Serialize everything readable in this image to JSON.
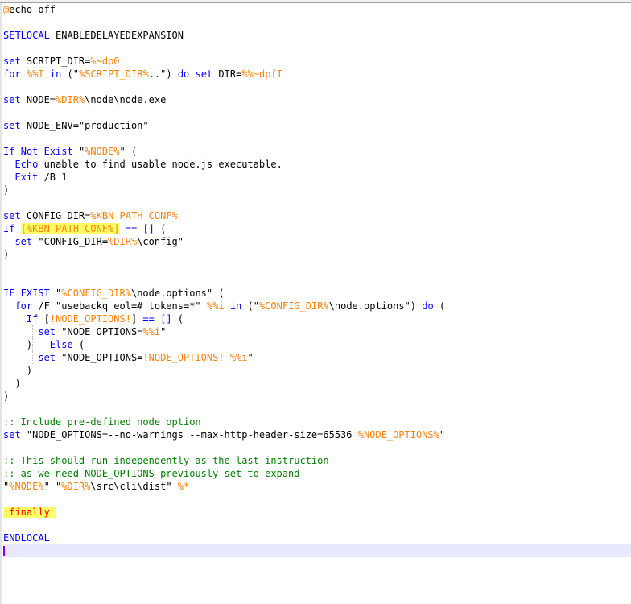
{
  "colors": {
    "keyword": "#0000ff",
    "variable": "#ff8000",
    "comment": "#008000",
    "label": "#ff0000",
    "highlight": "#ffff66",
    "text": "#000000",
    "current_line": "#e8e8ff",
    "caret": "#8000ff"
  },
  "editor": {
    "lines": [
      [
        {
          "t": "@",
          "c": "variable"
        },
        {
          "t": "echo off",
          "c": "text"
        }
      ],
      [],
      [
        {
          "t": "SETLOCAL",
          "c": "keyword"
        },
        {
          "t": " ENABLEDELAYEDEXPANSION",
          "c": "text"
        }
      ],
      [],
      [
        {
          "t": "set",
          "c": "keyword"
        },
        {
          "t": " SCRIPT_DIR=",
          "c": "text"
        },
        {
          "t": "%~dp0",
          "c": "variable"
        }
      ],
      [
        {
          "t": "for",
          "c": "keyword"
        },
        {
          "t": " ",
          "c": "text"
        },
        {
          "t": "%%I",
          "c": "variable"
        },
        {
          "t": " ",
          "c": "text"
        },
        {
          "t": "in",
          "c": "keyword"
        },
        {
          "t": " (\"",
          "c": "text"
        },
        {
          "t": "%SCRIPT_DIR%",
          "c": "variable"
        },
        {
          "t": "..\") ",
          "c": "text"
        },
        {
          "t": "do",
          "c": "keyword"
        },
        {
          "t": " ",
          "c": "text"
        },
        {
          "t": "set",
          "c": "keyword"
        },
        {
          "t": " DIR=",
          "c": "text"
        },
        {
          "t": "%%~dpfI",
          "c": "variable"
        }
      ],
      [],
      [
        {
          "t": "set",
          "c": "keyword"
        },
        {
          "t": " NODE=",
          "c": "text"
        },
        {
          "t": "%DIR%",
          "c": "variable"
        },
        {
          "t": "\\node\\node.exe",
          "c": "text"
        }
      ],
      [],
      [
        {
          "t": "set",
          "c": "keyword"
        },
        {
          "t": " NODE_ENV=\"production\"",
          "c": "text"
        }
      ],
      [],
      [
        {
          "t": "If",
          "c": "keyword"
        },
        {
          "t": " ",
          "c": "text"
        },
        {
          "t": "Not",
          "c": "keyword"
        },
        {
          "t": " ",
          "c": "text"
        },
        {
          "t": "Exist",
          "c": "keyword"
        },
        {
          "t": " \"",
          "c": "text"
        },
        {
          "t": "%NODE%",
          "c": "variable"
        },
        {
          "t": "\" (",
          "c": "text"
        }
      ],
      [
        {
          "t": "  ",
          "c": "text"
        },
        {
          "t": "Echo",
          "c": "keyword"
        },
        {
          "t": " unable to find usable node.js executable.",
          "c": "text"
        }
      ],
      [
        {
          "t": "  ",
          "c": "text"
        },
        {
          "t": "Exit",
          "c": "keyword"
        },
        {
          "t": " /B 1",
          "c": "text"
        }
      ],
      [
        {
          "t": ")",
          "c": "text"
        }
      ],
      [],
      [
        {
          "t": "set",
          "c": "keyword"
        },
        {
          "t": " CONFIG_DIR=",
          "c": "text"
        },
        {
          "t": "%KBN_PATH_CONF%",
          "c": "variable"
        }
      ],
      [
        {
          "t": "If",
          "c": "keyword"
        },
        {
          "t": " ",
          "c": "text"
        },
        {
          "t": "[%KBN_PATH_CONF%]",
          "c": "variable",
          "h": true
        },
        {
          "t": " ",
          "c": "text"
        },
        {
          "t": "==",
          "c": "keyword"
        },
        {
          "t": " ",
          "c": "text"
        },
        {
          "t": "[]",
          "c": "keyword"
        },
        {
          "t": " (",
          "c": "text"
        }
      ],
      [
        {
          "t": "  ",
          "c": "text"
        },
        {
          "t": "set",
          "c": "keyword"
        },
        {
          "t": " \"CONFIG_DIR=",
          "c": "text"
        },
        {
          "t": "%DIR%",
          "c": "variable"
        },
        {
          "t": "\\config\"",
          "c": "text"
        }
      ],
      [
        {
          "t": ")",
          "c": "text"
        }
      ],
      [],
      [],
      [
        {
          "t": "IF",
          "c": "keyword"
        },
        {
          "t": " ",
          "c": "text"
        },
        {
          "t": "EXIST",
          "c": "keyword"
        },
        {
          "t": " \"",
          "c": "text"
        },
        {
          "t": "%CONFIG_DIR%",
          "c": "variable"
        },
        {
          "t": "\\node.options\" (",
          "c": "text"
        }
      ],
      [
        {
          "t": "  ",
          "c": "text"
        },
        {
          "t": "for",
          "c": "keyword"
        },
        {
          "t": " /F \"usebackq eol=# tokens=*\" ",
          "c": "text"
        },
        {
          "t": "%%i",
          "c": "variable"
        },
        {
          "t": " ",
          "c": "text"
        },
        {
          "t": "in",
          "c": "keyword"
        },
        {
          "t": " (\"",
          "c": "text"
        },
        {
          "t": "%CONFIG_DIR%",
          "c": "variable"
        },
        {
          "t": "\\node.options\") ",
          "c": "text"
        },
        {
          "t": "do",
          "c": "keyword"
        },
        {
          "t": " (",
          "c": "text"
        }
      ],
      [
        {
          "t": "    ",
          "c": "text"
        },
        {
          "t": "If",
          "c": "keyword"
        },
        {
          "t": " [",
          "c": "text"
        },
        {
          "t": "!NODE_OPTIONS!",
          "c": "variable"
        },
        {
          "t": "] ",
          "c": "text"
        },
        {
          "t": "==",
          "c": "keyword"
        },
        {
          "t": " ",
          "c": "text"
        },
        {
          "t": "[]",
          "c": "keyword"
        },
        {
          "t": " (",
          "c": "text"
        }
      ],
      [
        {
          "t": "      ",
          "c": "text"
        },
        {
          "t": "set",
          "c": "keyword"
        },
        {
          "t": " \"NODE_OPTIONS=",
          "c": "text"
        },
        {
          "t": "%%i",
          "c": "variable"
        },
        {
          "t": "\"",
          "c": "text"
        }
      ],
      [
        {
          "t": "    )   ",
          "c": "text"
        },
        {
          "t": "Else",
          "c": "keyword"
        },
        {
          "t": " (",
          "c": "text"
        }
      ],
      [
        {
          "t": "      ",
          "c": "text"
        },
        {
          "t": "set",
          "c": "keyword"
        },
        {
          "t": " \"NODE_OPTIONS=",
          "c": "text"
        },
        {
          "t": "!NODE_OPTIONS!",
          "c": "variable"
        },
        {
          "t": " ",
          "c": "text"
        },
        {
          "t": "%%i",
          "c": "variable"
        },
        {
          "t": "\"",
          "c": "text"
        }
      ],
      [
        {
          "t": "    )",
          "c": "text"
        }
      ],
      [
        {
          "t": "  )",
          "c": "text"
        }
      ],
      [
        {
          "t": ")",
          "c": "text"
        }
      ],
      [],
      [
        {
          "t": ":: Include pre-defined node option",
          "c": "comment"
        }
      ],
      [
        {
          "t": "set",
          "c": "keyword"
        },
        {
          "t": " \"NODE_OPTIONS=--no-warnings --max-http-header-size=65536 ",
          "c": "text"
        },
        {
          "t": "%NODE_OPTIONS%",
          "c": "variable"
        },
        {
          "t": "\"",
          "c": "text"
        }
      ],
      [],
      [
        {
          "t": ":: This should run independently as the last instruction",
          "c": "comment"
        }
      ],
      [
        {
          "t": ":: as we need NODE_OPTIONS previously set to expand",
          "c": "comment"
        }
      ],
      [
        {
          "t": "\"",
          "c": "text"
        },
        {
          "t": "%NODE%",
          "c": "variable"
        },
        {
          "t": "\" \"",
          "c": "text"
        },
        {
          "t": "%DIR%",
          "c": "variable"
        },
        {
          "t": "\\src\\cli\\dist\" ",
          "c": "text"
        },
        {
          "t": "%*",
          "c": "variable"
        }
      ],
      [],
      [
        {
          "t": ":finally ",
          "c": "label",
          "h": true
        }
      ],
      [],
      [
        {
          "t": "ENDLOCAL",
          "c": "keyword"
        }
      ],
      []
    ]
  }
}
